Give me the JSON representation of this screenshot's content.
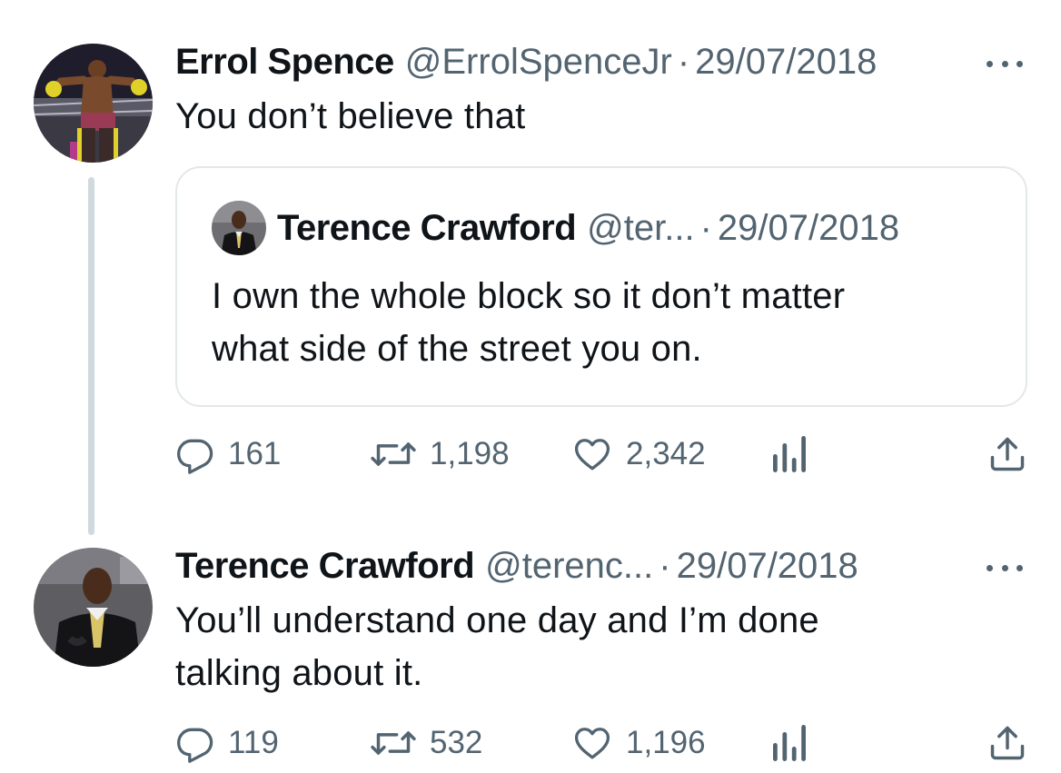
{
  "tweets": [
    {
      "author_name": "Errol Spence",
      "handle": "@ErrolSpenceJr",
      "separator": "·",
      "date": "29/07/2018",
      "text": "You don’t believe that",
      "avatar_icon": "avatar-boxer-photo",
      "quote": {
        "author_name": "Terence Crawford",
        "handle": "@ter...",
        "separator": "·",
        "date": "29/07/2018",
        "text_lines": [
          "I own the whole block so it don’t matter",
          "what side of the street you on."
        ],
        "avatar_icon": "avatar-suit-photo"
      },
      "stats": {
        "replies": "161",
        "reposts": "1,198",
        "likes": "2,342"
      }
    },
    {
      "author_name": "Terence Crawford",
      "handle": "@terenc...",
      "separator": "·",
      "date": "29/07/2018",
      "text_lines": [
        "You’ll understand one day and I’m done",
        "talking about it."
      ],
      "avatar_icon": "avatar-suit-photo",
      "stats": {
        "replies": "119",
        "reposts": "532",
        "likes": "1,196"
      }
    }
  ],
  "icons": {
    "reply": "reply-icon",
    "repost": "repost-icon",
    "like": "like-icon",
    "views": "views-icon",
    "share": "share-icon",
    "more": "more-icon"
  },
  "colors": {
    "text": "#0f1419",
    "secondary": "#536471",
    "border": "#e3e8eb",
    "thread_line": "#cfd9de"
  }
}
